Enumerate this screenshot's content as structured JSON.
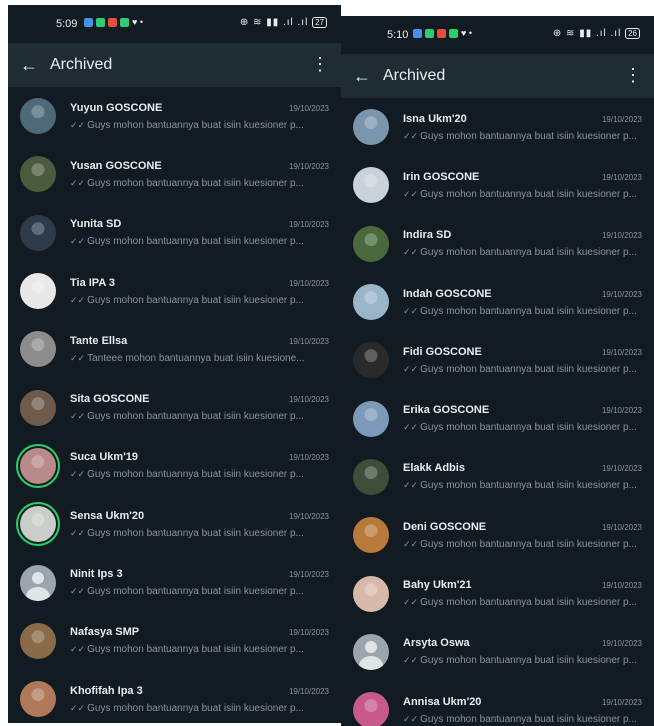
{
  "left": {
    "status": {
      "time": "5:09",
      "icons": "⊕ ≋ ▮▮ .ıl .ıl",
      "battery": "27"
    },
    "appbar": {
      "title": "Archived"
    },
    "chats": [
      {
        "name": "Yuyun GOSCONE",
        "date": "19/10/2023",
        "preview": "Guys mohon bantuannya buat isiin kuesioner p...",
        "avatar_color": "#4e6a7a",
        "ring": false
      },
      {
        "name": "Yusan GOSCONE",
        "date": "19/10/2023",
        "preview": "Guys mohon bantuannya buat isiin kuesioner p...",
        "avatar_color": "#4c5a3e",
        "ring": false
      },
      {
        "name": "Yunita SD",
        "date": "19/10/2023",
        "preview": "Guys mohon bantuannya buat isiin kuesioner p...",
        "avatar_color": "#2e3b4a",
        "ring": false
      },
      {
        "name": "Tia IPA 3",
        "date": "19/10/2023",
        "preview": "Guys mohon bantuannya buat isiin kuesioner p...",
        "avatar_color": "#e8e8e8",
        "ring": false
      },
      {
        "name": "Tante Ellsa",
        "date": "19/10/2023",
        "preview": "Tanteee mohon bantuannya buat isiin kuesione...",
        "avatar_color": "#8c8c8c",
        "ring": false
      },
      {
        "name": "Sita GOSCONE",
        "date": "19/10/2023",
        "preview": "Guys mohon bantuannya buat isiin kuesioner p...",
        "avatar_color": "#6e5b4c",
        "ring": false
      },
      {
        "name": "Suca Ukm'19",
        "date": "19/10/2023",
        "preview": "Guys mohon bantuannya buat isiin kuesioner p...",
        "avatar_color": "#b98a8a",
        "ring": true
      },
      {
        "name": "Sensa Ukm'20",
        "date": "19/10/2023",
        "preview": "Guys mohon bantuannya buat isiin kuesioner p...",
        "avatar_color": "#c9cfc8",
        "ring": true
      },
      {
        "name": "Ninit Ips 3",
        "date": "19/10/2023",
        "preview": "Guys mohon bantuannya buat isiin kuesioner p...",
        "avatar_color": "default",
        "ring": false
      },
      {
        "name": "Nafasya SMP",
        "date": "19/10/2023",
        "preview": "Guys mohon bantuannya buat isiin kuesioner p...",
        "avatar_color": "#8a6a48",
        "ring": false
      },
      {
        "name": "Khofifah Ipa 3",
        "date": "19/10/2023",
        "preview": "Guys mohon bantuannya buat isiin kuesioner p...",
        "avatar_color": "#b07a5a",
        "ring": false
      }
    ]
  },
  "right": {
    "status": {
      "time": "5:10",
      "icons": "⊕ ≋ ▮▮ .ıl .ıl",
      "battery": "26"
    },
    "appbar": {
      "title": "Archived"
    },
    "chats": [
      {
        "name": "Isna Ukm'20",
        "date": "19/10/2023",
        "preview": "Guys mohon bantuannya buat isiin kuesioner p...",
        "avatar_color": "#7a96ad",
        "ring": false
      },
      {
        "name": "Irin GOSCONE",
        "date": "19/10/2023",
        "preview": "Guys mohon bantuannya buat isiin kuesioner p...",
        "avatar_color": "#c9d2d8",
        "ring": false
      },
      {
        "name": "Indira SD",
        "date": "19/10/2023",
        "preview": "Guys mohon bantuannya buat isiin kuesioner p...",
        "avatar_color": "#4a6a3e",
        "ring": false
      },
      {
        "name": "Indah GOSCONE",
        "date": "19/10/2023",
        "preview": "Guys mohon bantuannya buat isiin kuesioner p...",
        "avatar_color": "#9ab4c8",
        "ring": false
      },
      {
        "name": "Fidi GOSCONE",
        "date": "19/10/2023",
        "preview": "Guys mohon bantuannya buat isiin kuesioner p...",
        "avatar_color": "#2a2a2a",
        "ring": false
      },
      {
        "name": "Erika GOSCONE",
        "date": "19/10/2023",
        "preview": "Guys mohon bantuannya buat isiin kuesioner p...",
        "avatar_color": "#7c9ab8",
        "ring": false
      },
      {
        "name": "Elakk Adbis",
        "date": "19/10/2023",
        "preview": "Guys mohon bantuannya buat isiin kuesioner p...",
        "avatar_color": "#3e4e3a",
        "ring": false
      },
      {
        "name": "Deni GOSCONE",
        "date": "19/10/2023",
        "preview": "Guys mohon bantuannya buat isiin kuesioner p...",
        "avatar_color": "#b87a3a",
        "ring": false
      },
      {
        "name": "Bahy Ukm'21",
        "date": "19/10/2023",
        "preview": "Guys mohon bantuannya buat isiin kuesioner p...",
        "avatar_color": "#d8b8a8",
        "ring": false
      },
      {
        "name": "Arsyta Oswa",
        "date": "19/10/2023",
        "preview": "Guys mohon bantuannya buat isiin kuesioner p...",
        "avatar_color": "default",
        "ring": false
      },
      {
        "name": "Annisa Ukm'20",
        "date": "19/10/2023",
        "preview": "Guys mohon bantuannya buat isiin kuesioner p...",
        "avatar_color": "#c85a8a",
        "ring": false
      }
    ]
  }
}
